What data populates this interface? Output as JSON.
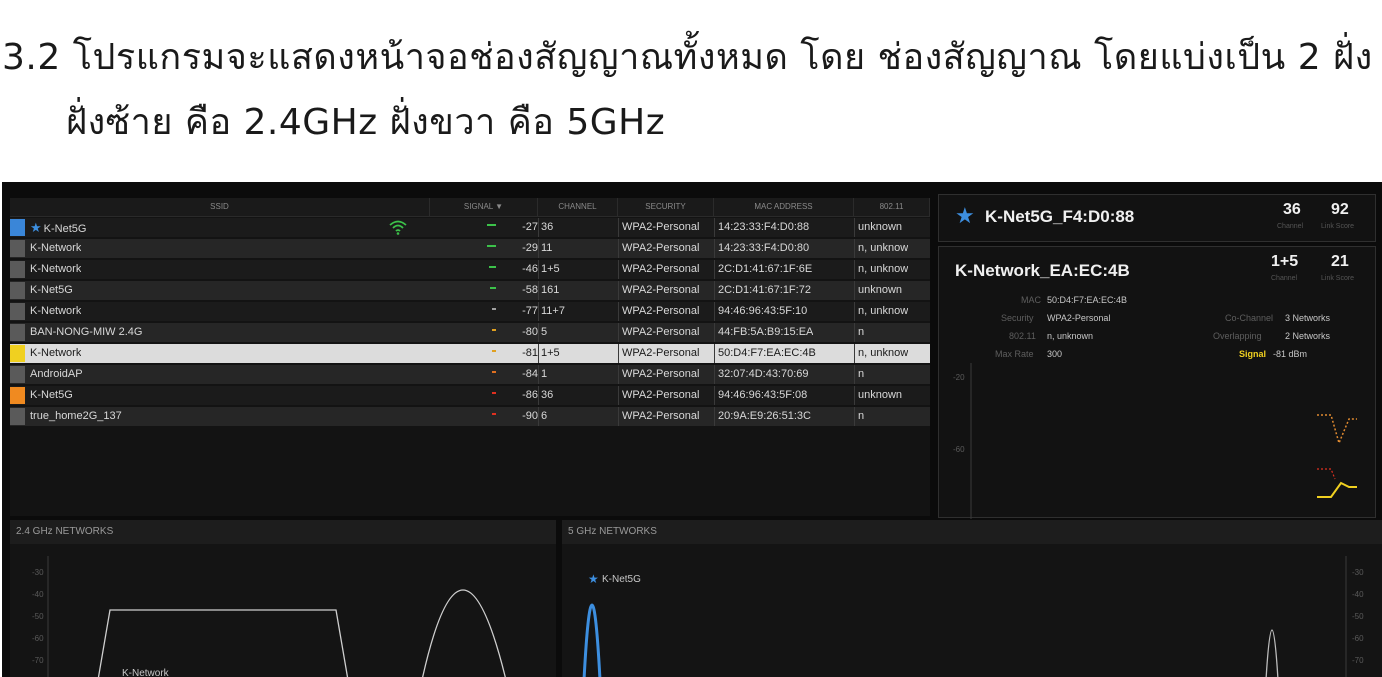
{
  "caption": {
    "line1": "3.2 โปรแกรมจะแสดงหน้าจอช่องสัญญาณทั้งหมด โดย ช่องสัญญาณ โดยแบ่งเป็น 2 ฝั่ง",
    "line2": "ฝั่งซ้าย คือ 2.4GHz ฝั่งขวา คือ 5GHz"
  },
  "table": {
    "headers": [
      "SSID",
      "SIGNAL ▼",
      "CHANNEL",
      "SECURITY",
      "MAC ADDRESS",
      "802.11"
    ],
    "rows": [
      {
        "ssid": "K-Net5G",
        "starred": true,
        "swatch": "#3a86d8",
        "signal": "-27",
        "bar_color": "#3cc24a",
        "bar_level": 0.9,
        "channel": "36",
        "security": "WPA2-Personal",
        "mac": "14:23:33:F4:D0:88",
        "phy": "unknown",
        "selected": false
      },
      {
        "ssid": "K-Network",
        "starred": false,
        "swatch": "#5a5a5a",
        "signal": "-29",
        "bar_color": "#3cc24a",
        "bar_level": 0.85,
        "channel": "11",
        "security": "WPA2-Personal",
        "mac": "14:23:33:F4:D0:80",
        "phy": "n, unknow",
        "selected": false
      },
      {
        "ssid": "K-Network",
        "starred": false,
        "swatch": "#5a5a5a",
        "signal": "-46",
        "bar_color": "#3cc24a",
        "bar_level": 0.7,
        "channel": "1+5",
        "security": "WPA2-Personal",
        "mac": "2C:D1:41:67:1F:6E",
        "phy": "n, unknow",
        "selected": false
      },
      {
        "ssid": "K-Net5G",
        "starred": false,
        "swatch": "#5a5a5a",
        "signal": "-58",
        "bar_color": "#3cc24a",
        "bar_level": 0.55,
        "channel": "161",
        "security": "WPA2-Personal",
        "mac": "2C:D1:41:67:1F:72",
        "phy": "unknown",
        "selected": false
      },
      {
        "ssid": "K-Network",
        "starred": false,
        "swatch": "#5a5a5a",
        "signal": "-77",
        "bar_color": "#a0a0a0",
        "bar_level": 0.35,
        "channel": "11+7",
        "security": "WPA2-Personal",
        "mac": "94:46:96:43:5F:10",
        "phy": "n, unknow",
        "selected": false
      },
      {
        "ssid": "BAN-NONG-MIW 2.4G",
        "starred": false,
        "swatch": "#5a5a5a",
        "signal": "-80",
        "bar_color": "#e0a020",
        "bar_level": 0.3,
        "channel": "5",
        "security": "WPA2-Personal",
        "mac": "44:FB:5A:B9:15:EA",
        "phy": "n",
        "selected": false
      },
      {
        "ssid": "K-Network",
        "starred": false,
        "swatch": "#f0d020",
        "signal": "-81",
        "bar_color": "#e0a020",
        "bar_level": 0.28,
        "channel": "1+5",
        "security": "WPA2-Personal",
        "mac": "50:D4:F7:EA:EC:4B",
        "phy": "n, unknow",
        "selected": true
      },
      {
        "ssid": "AndroidAP",
        "starred": false,
        "swatch": "#5a5a5a",
        "signal": "-84",
        "bar_color": "#e07020",
        "bar_level": 0.22,
        "channel": "1",
        "security": "WPA2-Personal",
        "mac": "32:07:4D:43:70:69",
        "phy": "n",
        "selected": false
      },
      {
        "ssid": "K-Net5G",
        "starred": false,
        "swatch": "#f08a20",
        "signal": "-86",
        "bar_color": "#e03020",
        "bar_level": 0.18,
        "channel": "36",
        "security": "WPA2-Personal",
        "mac": "94:46:96:43:5F:08",
        "phy": "unknown",
        "selected": false
      },
      {
        "ssid": "true_home2G_137",
        "starred": false,
        "swatch": "#5a5a5a",
        "signal": "-90",
        "bar_color": "#e03020",
        "bar_level": 0.1,
        "channel": "6",
        "security": "WPA2-Personal",
        "mac": "20:9A:E9:26:51:3C",
        "phy": "n",
        "selected": false
      }
    ]
  },
  "card1": {
    "title": "K-Net5G_F4:D0:88",
    "channel": "36",
    "channel_label": "Channel",
    "score": "92",
    "score_label": "Link Score"
  },
  "card2": {
    "title": "K-Network_EA:EC:4B",
    "channel": "1+5",
    "channel_label": "Channel",
    "score": "21",
    "score_label": "Link Score",
    "mac_label": "MAC",
    "mac": "50:D4:F7:EA:EC:4B",
    "security_label": "Security",
    "security": "WPA2-Personal",
    "phy_label": "802.11",
    "phy": "n, unknown",
    "maxrate_label": "Max Rate",
    "maxrate": "300",
    "cochannel_label": "Co-Channel",
    "cochannel": "3 Networks",
    "overlap_label": "Overlapping",
    "overlap": "2 Networks",
    "signal_label": "Signal",
    "signal": "-81 dBm",
    "axis": [
      "-20",
      "-60"
    ]
  },
  "panel24": {
    "title": "2.4 GHz NETWORKS",
    "ticks": [
      "-30",
      "-40",
      "-50",
      "-60",
      "-70"
    ],
    "label": "K-Network"
  },
  "panel5": {
    "title": "5 GHz NETWORKS",
    "ticks": [
      "-30",
      "-40",
      "-50",
      "-60",
      "-70"
    ],
    "label": "K-Net5G"
  },
  "colors": {
    "accent_blue": "#3d8fe0",
    "signal_yellow": "#f0d020",
    "signal_orange": "#e08a30"
  }
}
